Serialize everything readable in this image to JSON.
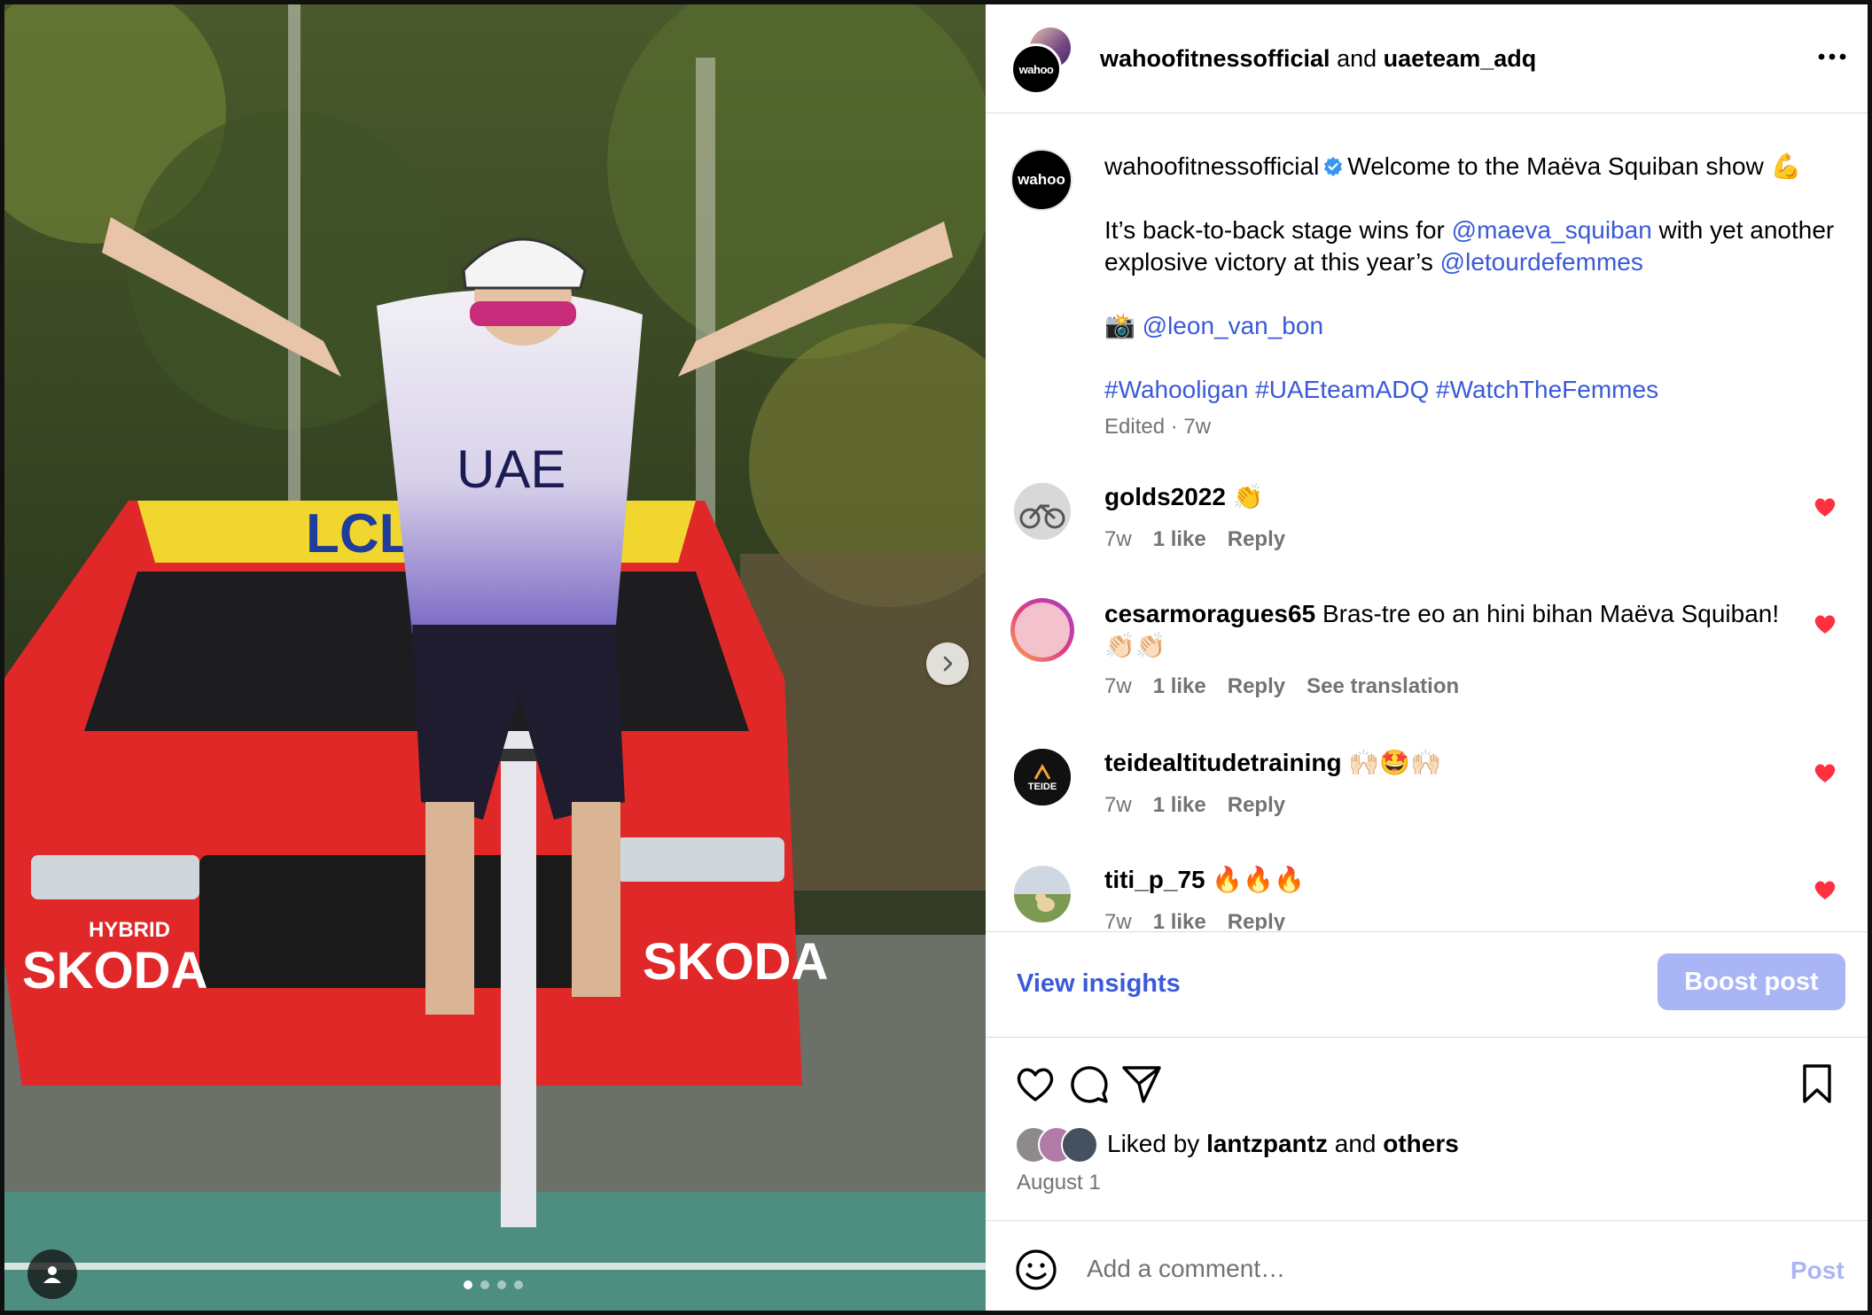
{
  "post": {
    "header": {
      "user1": "wahoofitnessofficial",
      "connector": "and",
      "user2": "uaeteam_adq",
      "avatar_label": "wahoo"
    },
    "caption": {
      "username": "wahoofitnessofficial",
      "line1": "Welcome to the Maëva Squiban show 💪",
      "line2_pre": "It’s back-to-back stage wins for ",
      "mention1": "@maeva_squiban",
      "line2_mid": " with yet another explosive victory at this year’s ",
      "mention2": "@letourdefemmes",
      "camera": "📸",
      "mention3": "@leon_van_bon",
      "hashtags": "#Wahooligan #UAEteamADQ #WatchTheFemmes",
      "meta": "Edited · 7w"
    },
    "comments": [
      {
        "user": "golds2022",
        "text": "👏",
        "age": "7w",
        "likes": "1 like",
        "reply": "Reply"
      },
      {
        "user": "cesarmoragues65",
        "text": "Bras-tre eo an hini bihan Maëva Squiban! 👏🏻👏🏻",
        "age": "7w",
        "likes": "1 like",
        "reply": "Reply",
        "translate": "See translation"
      },
      {
        "user": "teidealtitudetraining",
        "text": "🙌🏻🤩🙌🏻",
        "age": "7w",
        "likes": "1 like",
        "reply": "Reply",
        "avatar_label": "TEIDE"
      },
      {
        "user": "titi_p_75",
        "text": "🔥🔥🔥",
        "age": "7w",
        "likes": "1 like",
        "reply": "Reply"
      }
    ],
    "insights": {
      "view": "View insights",
      "boost": "Boost post"
    },
    "likes": {
      "prefix": "Liked by ",
      "user": "lantzpantz",
      "mid": " and ",
      "others": "others"
    },
    "date": "August 1",
    "add_comment": {
      "placeholder": "Add a comment…",
      "post": "Post"
    }
  },
  "media": {
    "photo_texts": {
      "car_brand": "SKODA",
      "sponsor_top": "LCL",
      "jersey": "UAE",
      "car_hybrid": "HYBRID"
    },
    "carousel_count": 4,
    "carousel_index": 0
  },
  "colors": {
    "accent": "#3a5ad8",
    "heart": "#ff3040",
    "boost_disabled": "#a9b5f5",
    "meta": "#737373"
  },
  "icons": [
    "heart-icon",
    "comment-icon",
    "share-icon",
    "bookmark-icon",
    "emoji-icon",
    "more-icon",
    "chevron-right-icon",
    "user-tag-icon",
    "verified-badge-icon"
  ]
}
